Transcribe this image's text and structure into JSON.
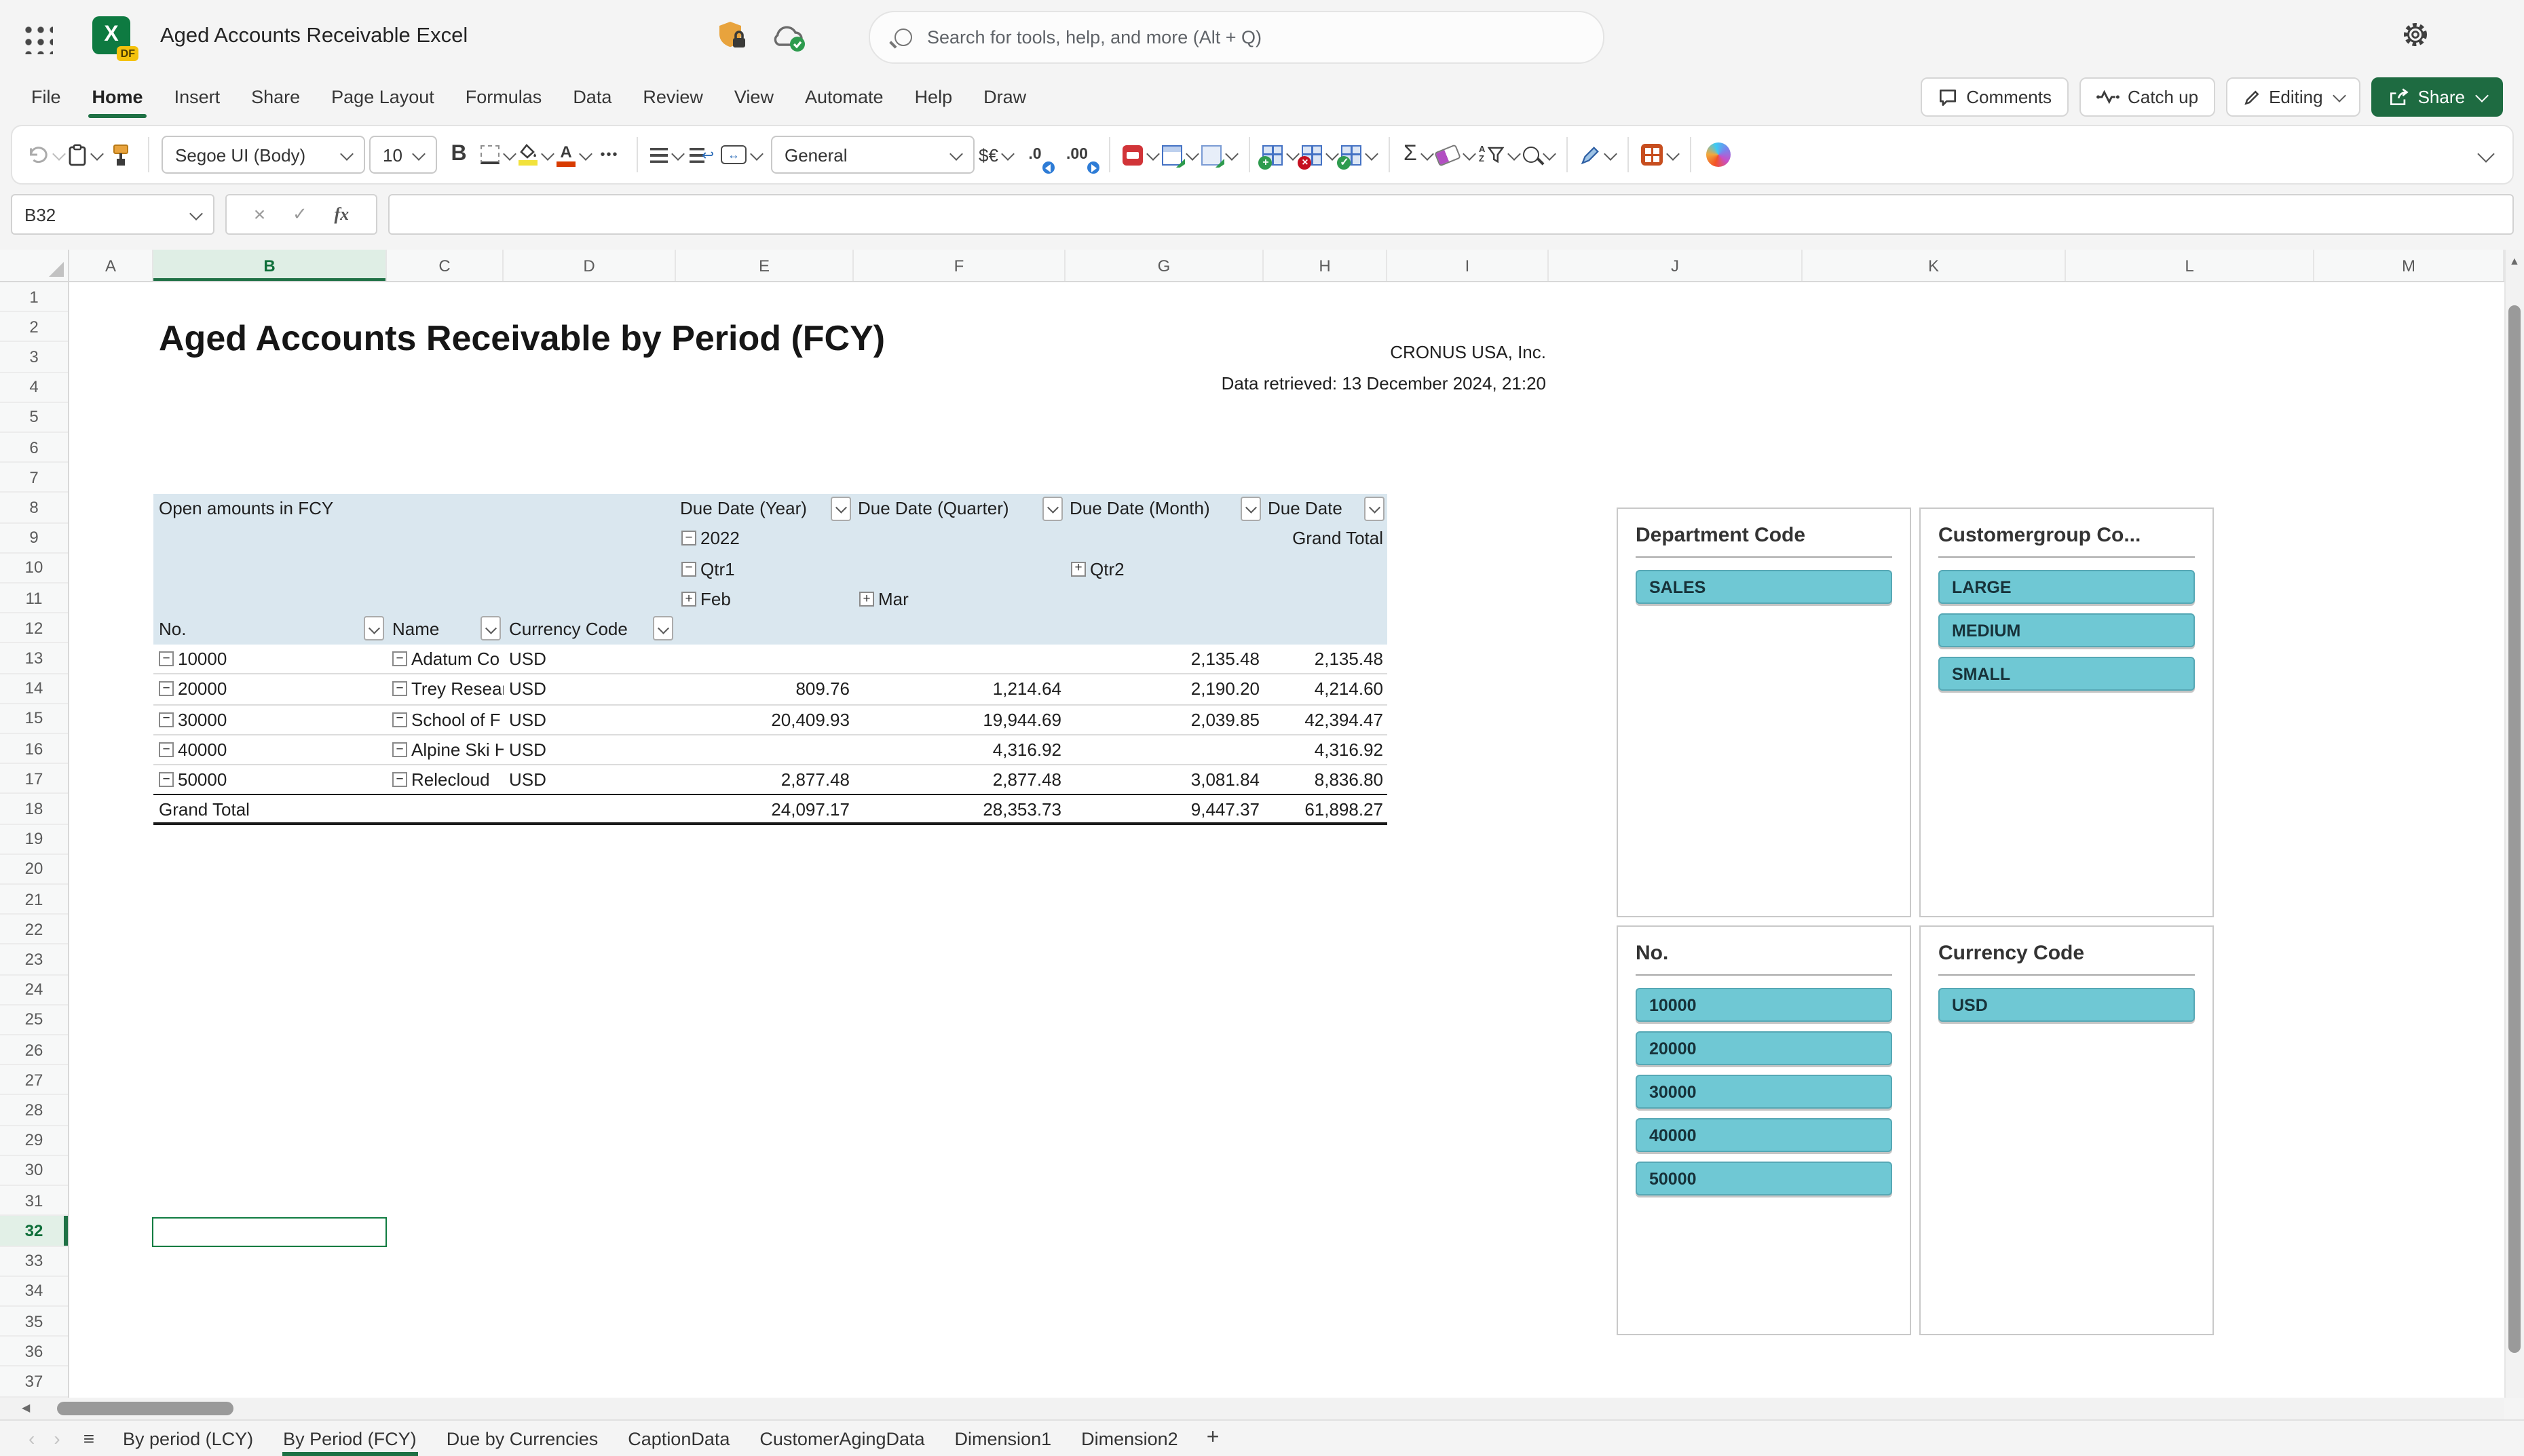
{
  "app": {
    "title": "Aged Accounts Receivable Excel",
    "logo_letter": "X",
    "logo_badge": "DF",
    "search_placeholder": "Search for tools, help, and more (Alt + Q)"
  },
  "ribbon": {
    "tabs": [
      "File",
      "Home",
      "Insert",
      "Share",
      "Page Layout",
      "Formulas",
      "Data",
      "Review",
      "View",
      "Automate",
      "Help",
      "Draw"
    ],
    "active_tab": "Home",
    "comments_label": "Comments",
    "catchup_label": "Catch up",
    "editing_label": "Editing",
    "share_label": "Share"
  },
  "toolbar": {
    "font_name": "Segoe UI (Body)",
    "font_size": "10",
    "number_format": "General",
    "bold_glyph": "B",
    "more_glyph": "•••",
    "sigma_glyph": "Σ",
    "currency_glyph": "$€",
    "dec0_glyph": ".0",
    "dec00_glyph": ".00",
    "font_color_glyph": "A",
    "sort_a": "A",
    "sort_z": "Z",
    "merge_glyph": "↔",
    "wrap_glyph": "↩"
  },
  "formula_bar": {
    "name_box": "B32",
    "cancel_glyph": "×",
    "check_glyph": "✓",
    "fx_glyph": "fx",
    "formula_value": ""
  },
  "grid": {
    "columns": [
      "A",
      "B",
      "C",
      "D",
      "E",
      "F",
      "G",
      "H",
      "I",
      "J",
      "K",
      "L",
      "M"
    ],
    "selected_column": "B",
    "row_count": 37,
    "selected_row": 32
  },
  "document": {
    "title": "Aged Accounts Receivable by Period (FCY)",
    "company": "CRONUS USA, Inc.",
    "retrieved": "Data retrieved: 13 December 2024, 21:20"
  },
  "pivot": {
    "caption": "Open amounts in FCY",
    "column_fields": [
      "Due Date (Year)",
      "Due Date (Quarter)",
      "Due Date (Month)",
      "Due Date"
    ],
    "year_label": "2022",
    "year_sign": "−",
    "grand_total_header": "Grand Total",
    "quarters": [
      {
        "label": "Qtr1",
        "sign": "−",
        "col": "E"
      },
      {
        "label": "Qtr2",
        "sign": "+",
        "col": "G"
      }
    ],
    "months": [
      {
        "label": "Feb",
        "sign": "+",
        "col": "E"
      },
      {
        "label": "Mar",
        "sign": "+",
        "col": "F"
      }
    ],
    "row_fields": [
      "No.",
      "Name",
      "Currency Code"
    ],
    "rows": [
      {
        "no": "10000",
        "name": "Adatum Co",
        "currency": "USD",
        "feb": "",
        "mar": "",
        "qtr2": "2,135.48",
        "total": "2,135.48"
      },
      {
        "no": "20000",
        "name": "Trey Resear",
        "currency": "USD",
        "feb": "809.76",
        "mar": "1,214.64",
        "qtr2": "2,190.20",
        "total": "4,214.60"
      },
      {
        "no": "30000",
        "name": "School of F",
        "currency": "USD",
        "feb": "20,409.93",
        "mar": "19,944.69",
        "qtr2": "2,039.85",
        "total": "42,394.47"
      },
      {
        "no": "40000",
        "name": "Alpine Ski H",
        "currency": "USD",
        "feb": "",
        "mar": "4,316.92",
        "qtr2": "",
        "total": "4,316.92"
      },
      {
        "no": "50000",
        "name": "Relecloud",
        "currency": "USD",
        "feb": "2,877.48",
        "mar": "2,877.48",
        "qtr2": "3,081.84",
        "total": "8,836.80"
      }
    ],
    "grand_total": {
      "label": "Grand Total",
      "feb": "24,097.17",
      "mar": "28,353.73",
      "qtr2": "9,447.37",
      "total": "61,898.27"
    }
  },
  "slicers": [
    {
      "title": "Department Code",
      "items": [
        "SALES"
      ]
    },
    {
      "title": "Customergroup Co...",
      "items": [
        "LARGE",
        "MEDIUM",
        "SMALL"
      ]
    },
    {
      "title": "No.",
      "items": [
        "10000",
        "20000",
        "30000",
        "40000",
        "50000"
      ]
    },
    {
      "title": "Currency Code",
      "items": [
        "USD"
      ]
    }
  ],
  "sheet_tabs": {
    "tabs": [
      "By period (LCY)",
      "By Period (FCY)",
      "Due by Currencies",
      "CaptionData",
      "CustomerAgingData",
      "Dimension1",
      "Dimension2"
    ],
    "active": "By Period (FCY)",
    "add_glyph": "+",
    "nav_left": "‹",
    "nav_right": "›",
    "menu_glyph": "≡"
  },
  "scrollbar": {
    "up_glyph": "▲",
    "left_glyph": "◀"
  },
  "colors": {
    "excel_green": "#1F7145",
    "share_button": "#1E6B41",
    "pivot_header_bg": "#DAE7EF",
    "slicer_fill": "#6FC8D4",
    "slicer_border": "#56A8B5"
  }
}
